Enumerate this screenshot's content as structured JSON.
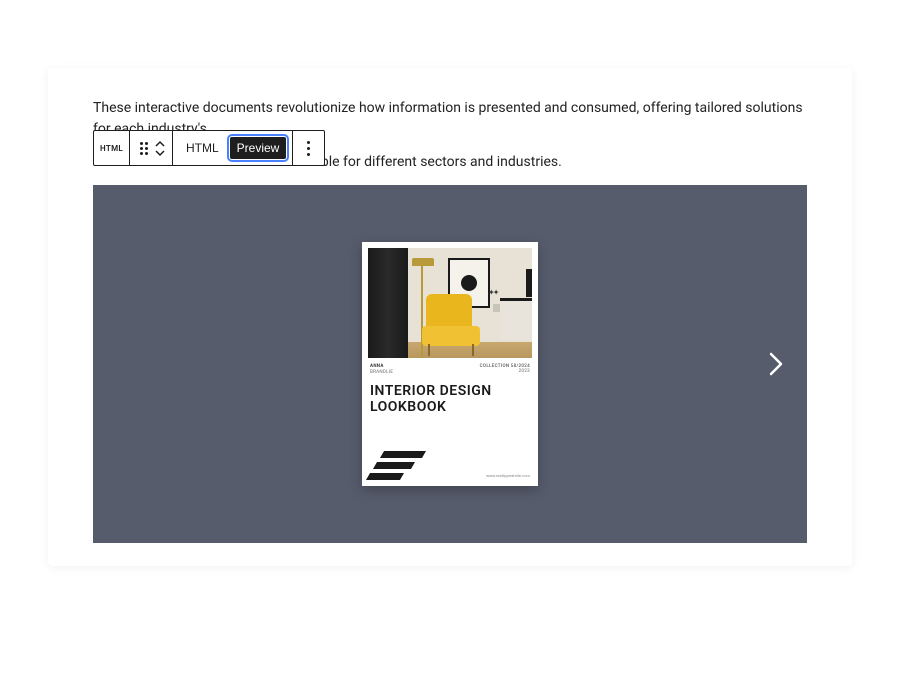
{
  "paragraph": {
    "line1": "These interactive documents revolutionize how information is presented and consumed, offering tailored solutions for each industry's",
    "line2_suffix": "ates suitable for different sectors and industries."
  },
  "toolbar": {
    "block_type_label": "HTML",
    "tab_html": "HTML",
    "tab_preview": "Preview"
  },
  "cover": {
    "meta_author_label": "ANNA",
    "meta_author_value": "BRANDLIE",
    "meta_right_label": "COLLECTION 58/2024",
    "meta_right_value": "2023",
    "title_line1": "INTERIOR DESIGN",
    "title_line2": "LOOKBOOK",
    "url": "www.reallygreatsite.com"
  },
  "colors": {
    "frame_bg": "#565c6c",
    "accent_yellow": "#e9b61e"
  }
}
